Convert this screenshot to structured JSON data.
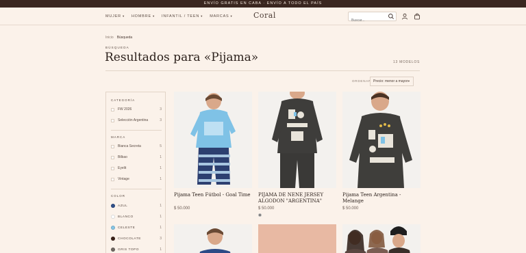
{
  "announcement": "ENVÍO GRATIS EN CABA · ENVÍO A TODO EL PAÍS",
  "nav": [
    {
      "label": "MUJER"
    },
    {
      "label": "HOMBRE"
    },
    {
      "label": "INFANTIL / TEEN"
    },
    {
      "label": "MARCAS"
    }
  ],
  "logo": "Coral",
  "search": {
    "placeholder": "Buscar..."
  },
  "breadcrumb": {
    "home": "Inicio",
    "current": "Búsqueda"
  },
  "kicker": "BÚSQUEDA",
  "title": "Resultados para «Pijama»",
  "count": "13 MODELOS",
  "sort": {
    "label": "ORDENAR",
    "value": "Precio: menor a mayor"
  },
  "filters": {
    "category": {
      "title": "CATEGORÍA",
      "items": [
        {
          "label": "FW 2026",
          "count": "3"
        },
        {
          "label": "Selección Argentina",
          "count": "3"
        }
      ]
    },
    "brand": {
      "title": "MARCA",
      "items": [
        {
          "label": "Bianca Secreta",
          "count": "5"
        },
        {
          "label": "Bilbao",
          "count": "1"
        },
        {
          "label": "Eyelit",
          "count": "1"
        },
        {
          "label": "Vintage",
          "count": "1"
        }
      ]
    },
    "color": {
      "title": "COLOR",
      "items": [
        {
          "label": "AZUL",
          "count": "1",
          "color": "#2f4f8a"
        },
        {
          "label": "BLANCO",
          "count": "1",
          "color": "#ffffff"
        },
        {
          "label": "CELESTE",
          "count": "1",
          "color": "#86c6e6"
        },
        {
          "label": "CHOCOLATE",
          "count": "3",
          "color": "#3a2118"
        },
        {
          "label": "GRIS TOPO",
          "count": "1",
          "color": "#6f6862"
        }
      ]
    }
  },
  "products": [
    {
      "name": "Pijama Teen Fútbol - Goal Time",
      "price": "$ 50.000"
    },
    {
      "name": "PIJAMA DE NENE JERSEY ALGODON \"ARGENTINA\"",
      "price": "$ 50.000",
      "swatch": "#7a7a7a"
    },
    {
      "name": "Pijama Teen Argentina - Melange",
      "price": "$ 50.000"
    }
  ]
}
